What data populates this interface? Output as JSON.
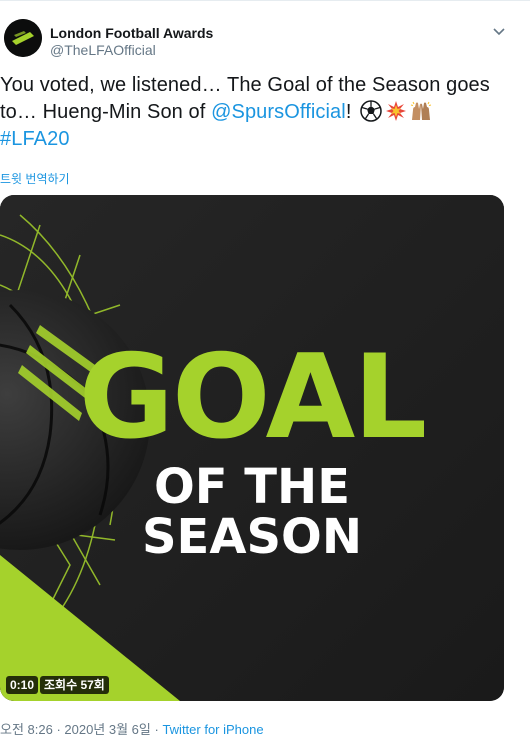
{
  "account": {
    "display_name": "London Football Awards",
    "handle": "@TheLFAOfficial",
    "avatar_icon": "lfa-logo-icon"
  },
  "tweet": {
    "text_part1": "You voted, we listened… The Goal of the Season goes to… Hueng-Min Son of ",
    "mention": "@SpursOfficial",
    "text_part2": "! ",
    "hashtag": "#LFA20",
    "emojis": [
      "soccer-ball-icon",
      "collision-icon",
      "raising-hands-icon"
    ],
    "translate_label": "트윗 번역하기"
  },
  "media": {
    "title_line1": "GOAL",
    "title_line2": "OF THE",
    "title_line3": "SEASON",
    "elapsed": "0:10",
    "views": "조회수 57회",
    "accent_color": "#a5d22c",
    "background_color": "#1e1e1e"
  },
  "footer": {
    "timestamp": "오전 8:26 · 2020년 3월 6일",
    "separator": " · ",
    "source": "Twitter for iPhone"
  },
  "colors": {
    "link": "#1b95e0",
    "secondary_text": "#657786"
  }
}
